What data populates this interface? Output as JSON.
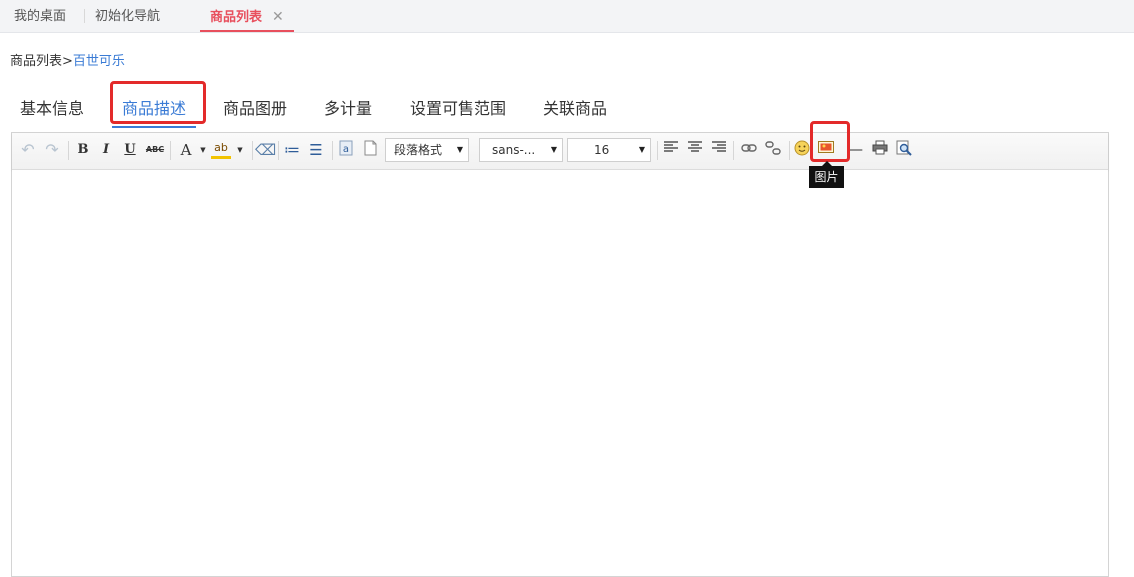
{
  "top_tabs": [
    {
      "label": "我的桌面"
    },
    {
      "label": "初始化导航"
    },
    {
      "label": "商品列表",
      "close": "✕"
    }
  ],
  "breadcrumb": {
    "parent": "商品列表",
    "separator": ">",
    "current": "百世可乐"
  },
  "content_tabs": [
    {
      "label": "基本信息"
    },
    {
      "label": "商品描述"
    },
    {
      "label": "商品图册"
    },
    {
      "label": "多计量"
    },
    {
      "label": "设置可售范围"
    },
    {
      "label": "关联商品"
    }
  ],
  "toolbar": {
    "undo": "↶",
    "redo": "↷",
    "bold": "B",
    "italic": "I",
    "underline": "U",
    "strikethrough": "ABC",
    "font_color": "A",
    "highlight": "ab",
    "eraser": "⌫",
    "ordered_list": "≔",
    "unordered_list": "☰",
    "paragraph_format": "段落格式",
    "font_family": "sans-...",
    "font_size": "16",
    "dropdown_arrow": "▼",
    "hr": "—"
  },
  "tooltip": "图片",
  "colors": {
    "active_red": "#e84f5d",
    "link_blue": "#3a7bd5",
    "highlight_box": "#e32a2a"
  }
}
